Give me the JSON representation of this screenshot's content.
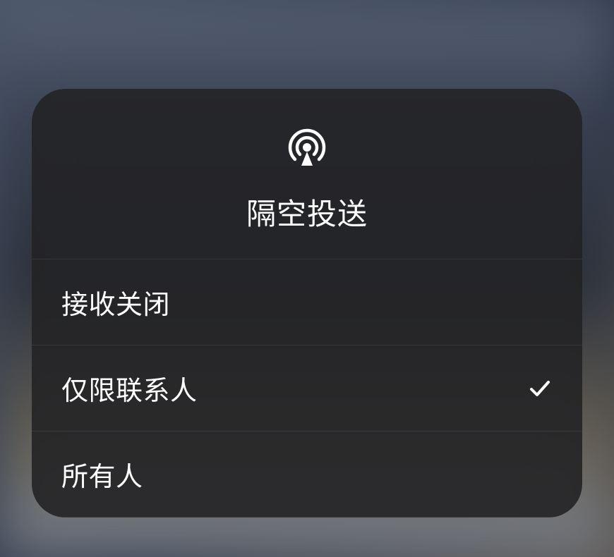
{
  "header": {
    "title": "隔空投送",
    "icon_name": "airdrop-icon"
  },
  "options": [
    {
      "label": "接收关闭",
      "selected": false
    },
    {
      "label": "仅限联系人",
      "selected": true
    },
    {
      "label": "所有人",
      "selected": false
    }
  ]
}
